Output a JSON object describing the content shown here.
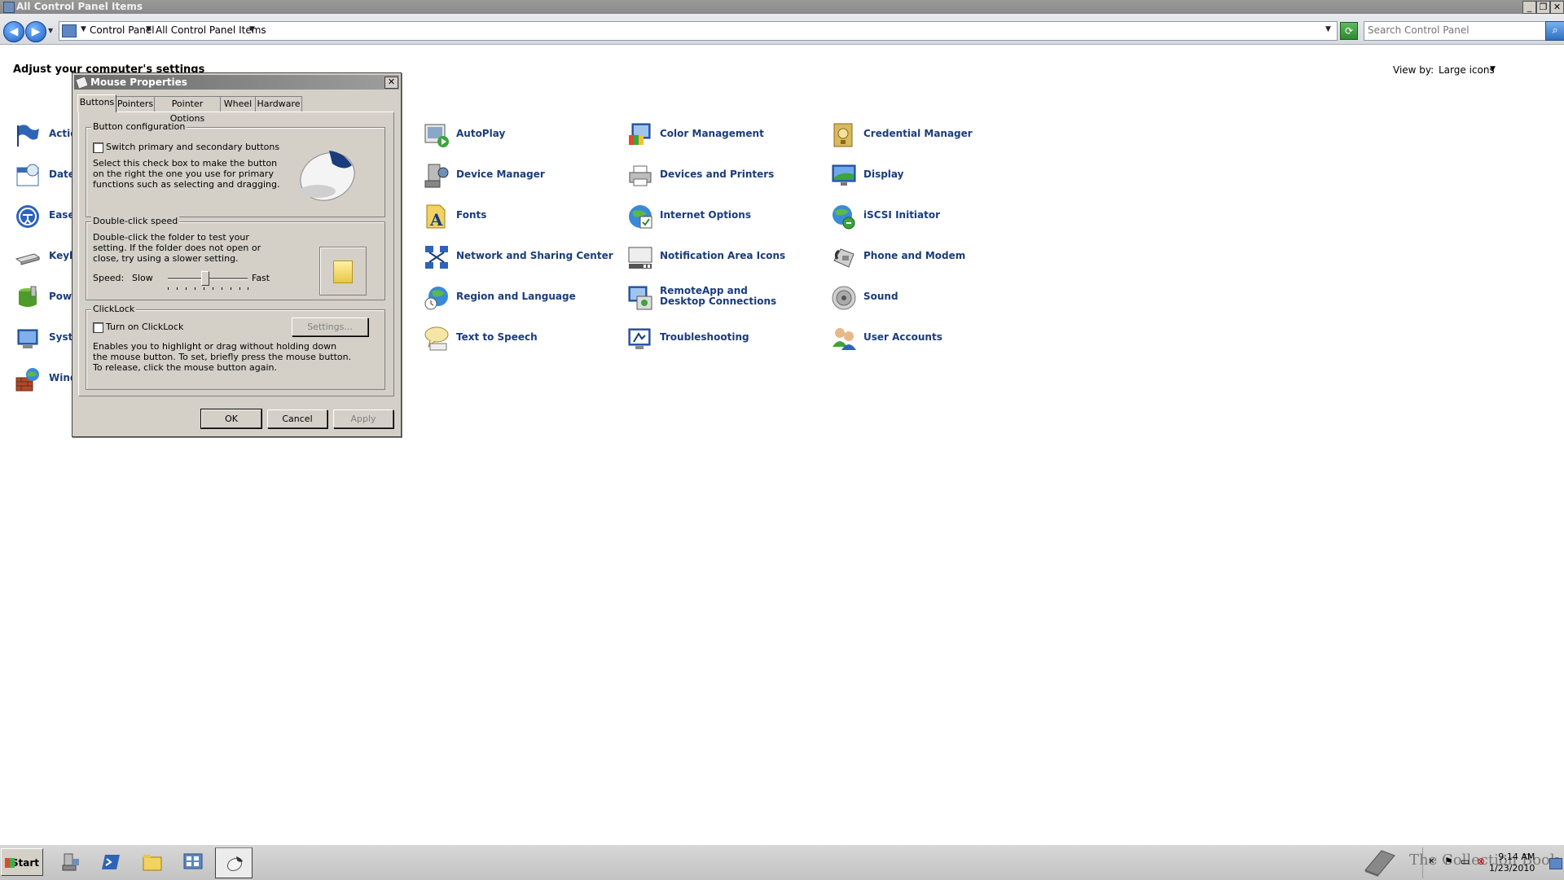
{
  "window": {
    "title": "All Control Panel Items"
  },
  "address": {
    "crumbs": [
      "Control Panel",
      "All Control Panel Items"
    ],
    "search_placeholder": "Search Control Panel"
  },
  "header": {
    "adjust_text": "Adjust your computer's settings",
    "view_by_label": "View by:",
    "view_by_value": "Large icons"
  },
  "left_items": [
    "Actic",
    "Date",
    "Ease",
    "Keyb",
    "Powe",
    "Syst",
    "Wind"
  ],
  "items": {
    "col1": [
      "AutoPlay",
      "Device Manager",
      "Fonts",
      "Network and Sharing Center",
      "Region and Language",
      "Text to Speech"
    ],
    "col2": [
      "Color Management",
      "Devices and Printers",
      "Internet Options",
      "Notification Area Icons",
      "RemoteApp and Desktop Connections",
      "Troubleshooting"
    ],
    "col3": [
      "Credential Manager",
      "Display",
      "iSCSI Initiator",
      "Phone and Modem",
      "Sound",
      "User Accounts"
    ]
  },
  "dialog": {
    "title": "Mouse Properties",
    "tabs": [
      "Buttons",
      "Pointers",
      "Pointer Options",
      "Wheel",
      "Hardware"
    ],
    "button_config": {
      "title": "Button configuration",
      "checkbox_label": "Switch primary and secondary buttons",
      "description": "Select this check box to make the button on the right the one you use for primary functions such as selecting and dragging."
    },
    "double_click": {
      "title": "Double-click speed",
      "description": "Double-click the folder to test your setting. If the folder does not open or close, try using a slower setting.",
      "speed_label": "Speed:",
      "slow_label": "Slow",
      "fast_label": "Fast",
      "speed_fraction": 0.5
    },
    "clicklock": {
      "title": "ClickLock",
      "checkbox_label": "Turn on ClickLock",
      "settings_label": "Settings...",
      "description": "Enables you to highlight or drag without holding down the mouse button. To set, briefly press the mouse button. To release, click the mouse button again."
    },
    "ok_label": "OK",
    "cancel_label": "Cancel",
    "apply_label": "Apply"
  },
  "taskbar": {
    "start_label": "Start",
    "clock_time": "9:14 AM",
    "clock_date": "1/23/2010",
    "watermark": "The Collection Book"
  }
}
